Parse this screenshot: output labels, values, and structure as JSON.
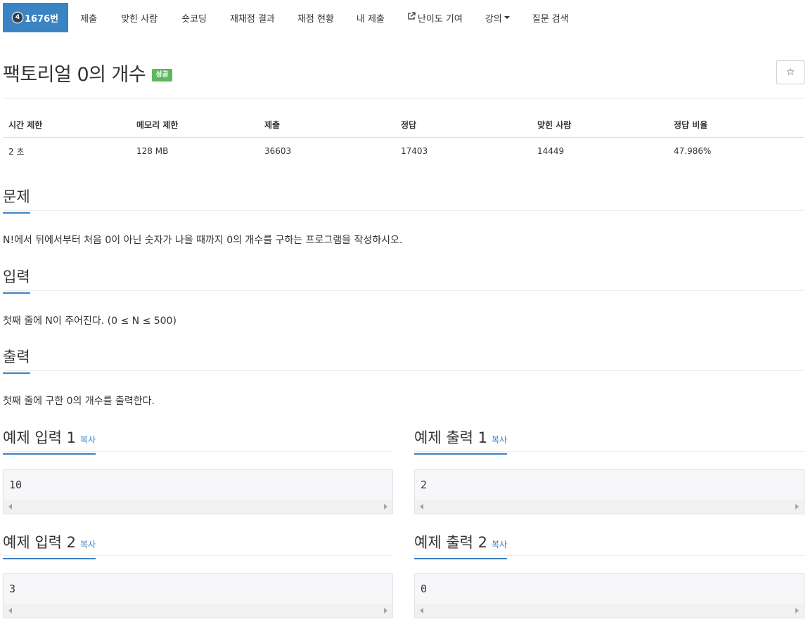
{
  "nav": {
    "active": {
      "tier": "4",
      "label": "1676번"
    },
    "items": [
      "제출",
      "맞힌 사람",
      "숏코딩",
      "재채점 결과",
      "채점 현황",
      "내 제출",
      "난이도 기여",
      "강의",
      "질문 검색"
    ]
  },
  "problem": {
    "title": "팩토리얼 0의 개수",
    "status": "성공",
    "star": "☆"
  },
  "info": {
    "headers": [
      "시간 제한",
      "메모리 제한",
      "제출",
      "정답",
      "맞힌 사람",
      "정답 비율"
    ],
    "values": [
      "2 초",
      "128 MB",
      "36603",
      "17403",
      "14449",
      "47.986%"
    ]
  },
  "sections": {
    "problem": {
      "heading": "문제",
      "text": "N!에서 뒤에서부터 처음 0이 아닌 숫자가 나올 때까지 0의 개수를 구하는 프로그램을 작성하시오."
    },
    "input": {
      "heading": "입력",
      "text": "첫째 줄에 N이 주어진다. (0 ≤ N ≤ 500)"
    },
    "output": {
      "heading": "출력",
      "text": "첫째 줄에 구한 0의 개수를 출력한다."
    }
  },
  "samples": {
    "copy_label": "복사",
    "input1": {
      "heading": "예제 입력 1",
      "value": "10"
    },
    "output1": {
      "heading": "예제 출력 1",
      "value": "2"
    },
    "input2": {
      "heading": "예제 입력 2",
      "value": "3"
    },
    "output2": {
      "heading": "예제 출력 2",
      "value": "0"
    }
  }
}
